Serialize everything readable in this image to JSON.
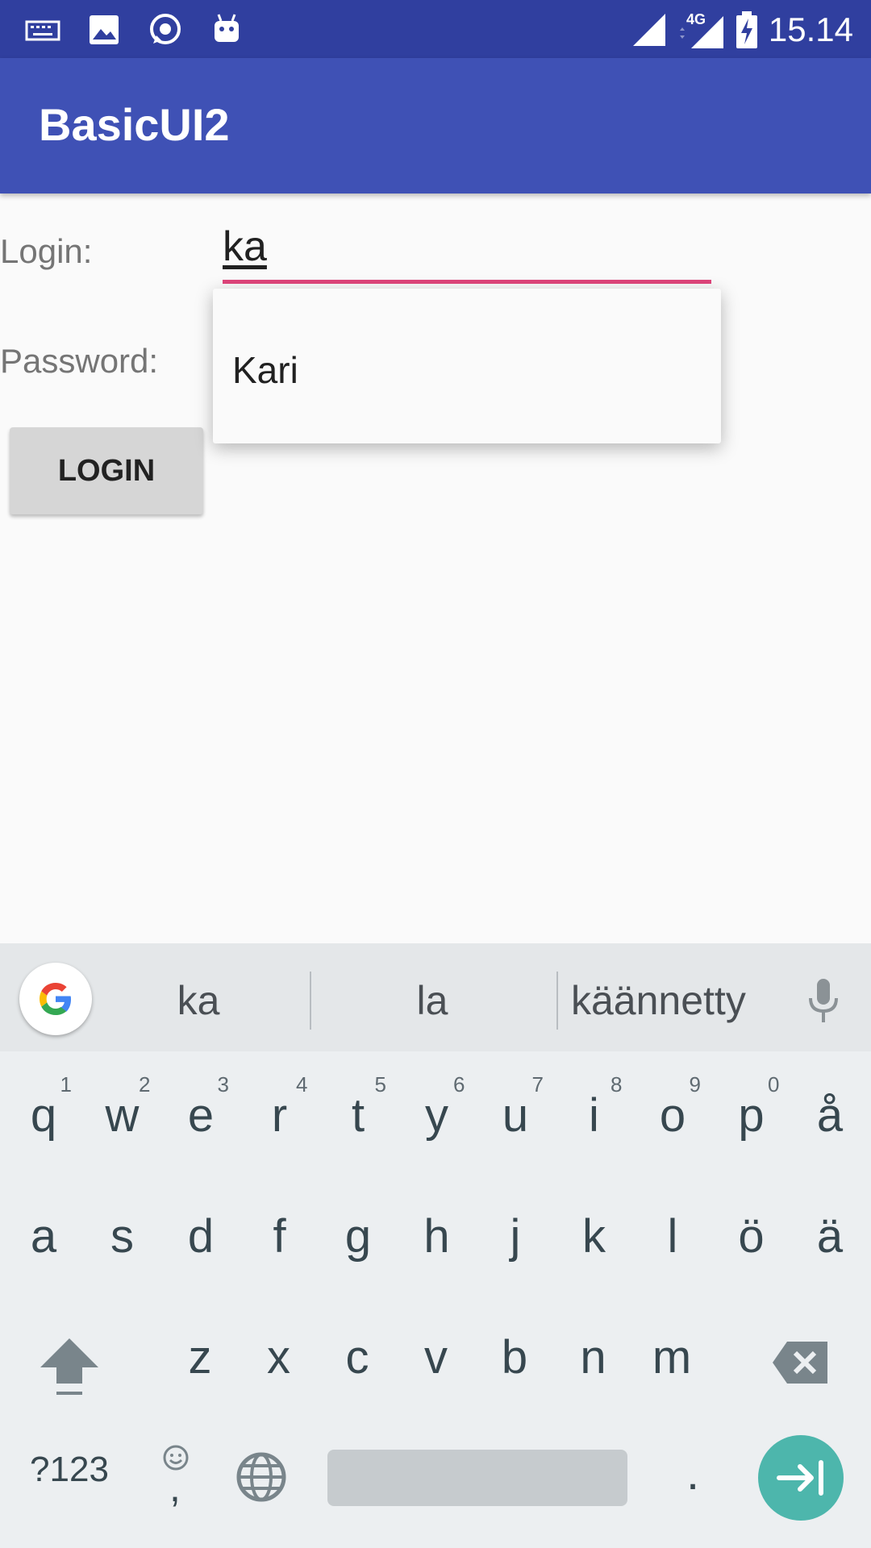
{
  "status_bar": {
    "time": "15.14",
    "network": "4G"
  },
  "app_bar": {
    "title": "BasicUI2"
  },
  "form": {
    "login_label": "Login:",
    "login_value": "ka",
    "password_label": "Password:",
    "login_button": "LOGIN"
  },
  "autocomplete": {
    "items": [
      "Kari"
    ]
  },
  "keyboard": {
    "suggestions": [
      "ka",
      "la",
      "käännetty"
    ],
    "row1": [
      {
        "k": "q",
        "n": "1"
      },
      {
        "k": "w",
        "n": "2"
      },
      {
        "k": "e",
        "n": "3"
      },
      {
        "k": "r",
        "n": "4"
      },
      {
        "k": "t",
        "n": "5"
      },
      {
        "k": "y",
        "n": "6"
      },
      {
        "k": "u",
        "n": "7"
      },
      {
        "k": "i",
        "n": "8"
      },
      {
        "k": "o",
        "n": "9"
      },
      {
        "k": "p",
        "n": "0"
      },
      {
        "k": "å",
        "n": ""
      }
    ],
    "row2": [
      "a",
      "s",
      "d",
      "f",
      "g",
      "h",
      "j",
      "k",
      "l",
      "ö",
      "ä"
    ],
    "row3": [
      "z",
      "x",
      "c",
      "v",
      "b",
      "n",
      "m"
    ],
    "symbols_label": "?123",
    "comma": ",",
    "period": "."
  },
  "colors": {
    "status_bar": "#303f9f",
    "app_bar": "#3f51b5",
    "accent": "#e0457b",
    "enter_key": "#4db6ac"
  }
}
